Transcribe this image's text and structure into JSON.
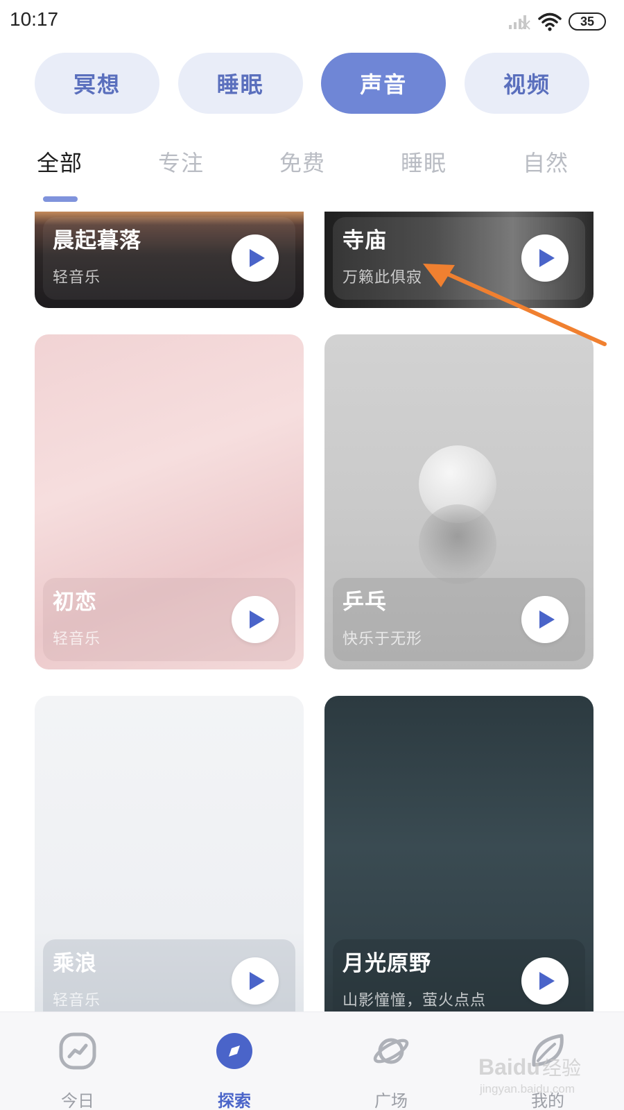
{
  "status_bar": {
    "time": "10:17",
    "battery": "35"
  },
  "categories": [
    {
      "label": "冥想",
      "active": false
    },
    {
      "label": "睡眠",
      "active": false
    },
    {
      "label": "声音",
      "active": true
    },
    {
      "label": "视频",
      "active": false
    }
  ],
  "tabs": [
    {
      "label": "全部",
      "active": true
    },
    {
      "label": "专注",
      "active": false
    },
    {
      "label": "免费",
      "active": false
    },
    {
      "label": "睡眠",
      "active": false
    },
    {
      "label": "自然",
      "active": false
    }
  ],
  "cards": [
    {
      "title": "晨起暮落",
      "subtitle": "轻音乐"
    },
    {
      "title": "寺庙",
      "subtitle": "万籁此俱寂"
    },
    {
      "title": "初恋",
      "subtitle": "轻音乐"
    },
    {
      "title": "乒乓",
      "subtitle": "快乐于无形"
    },
    {
      "title": "乘浪",
      "subtitle": "轻音乐"
    },
    {
      "title": "月光原野",
      "subtitle": "山影憧憧，萤火点点"
    }
  ],
  "bottom_nav": [
    {
      "label": "今日",
      "icon": "chart-icon",
      "active": false
    },
    {
      "label": "探索",
      "icon": "compass-icon",
      "active": true
    },
    {
      "label": "广场",
      "icon": "planet-icon",
      "active": false
    },
    {
      "label": "我的",
      "icon": "leaf-icon",
      "active": false
    }
  ],
  "watermark": {
    "brand": "Baidu经验",
    "url": "jingyan.baidu.com"
  },
  "colors": {
    "accent": "#6f86d6",
    "pill_bg": "#e9edf8",
    "play_icon": "#4a64c9",
    "annotation": "#f08030"
  }
}
